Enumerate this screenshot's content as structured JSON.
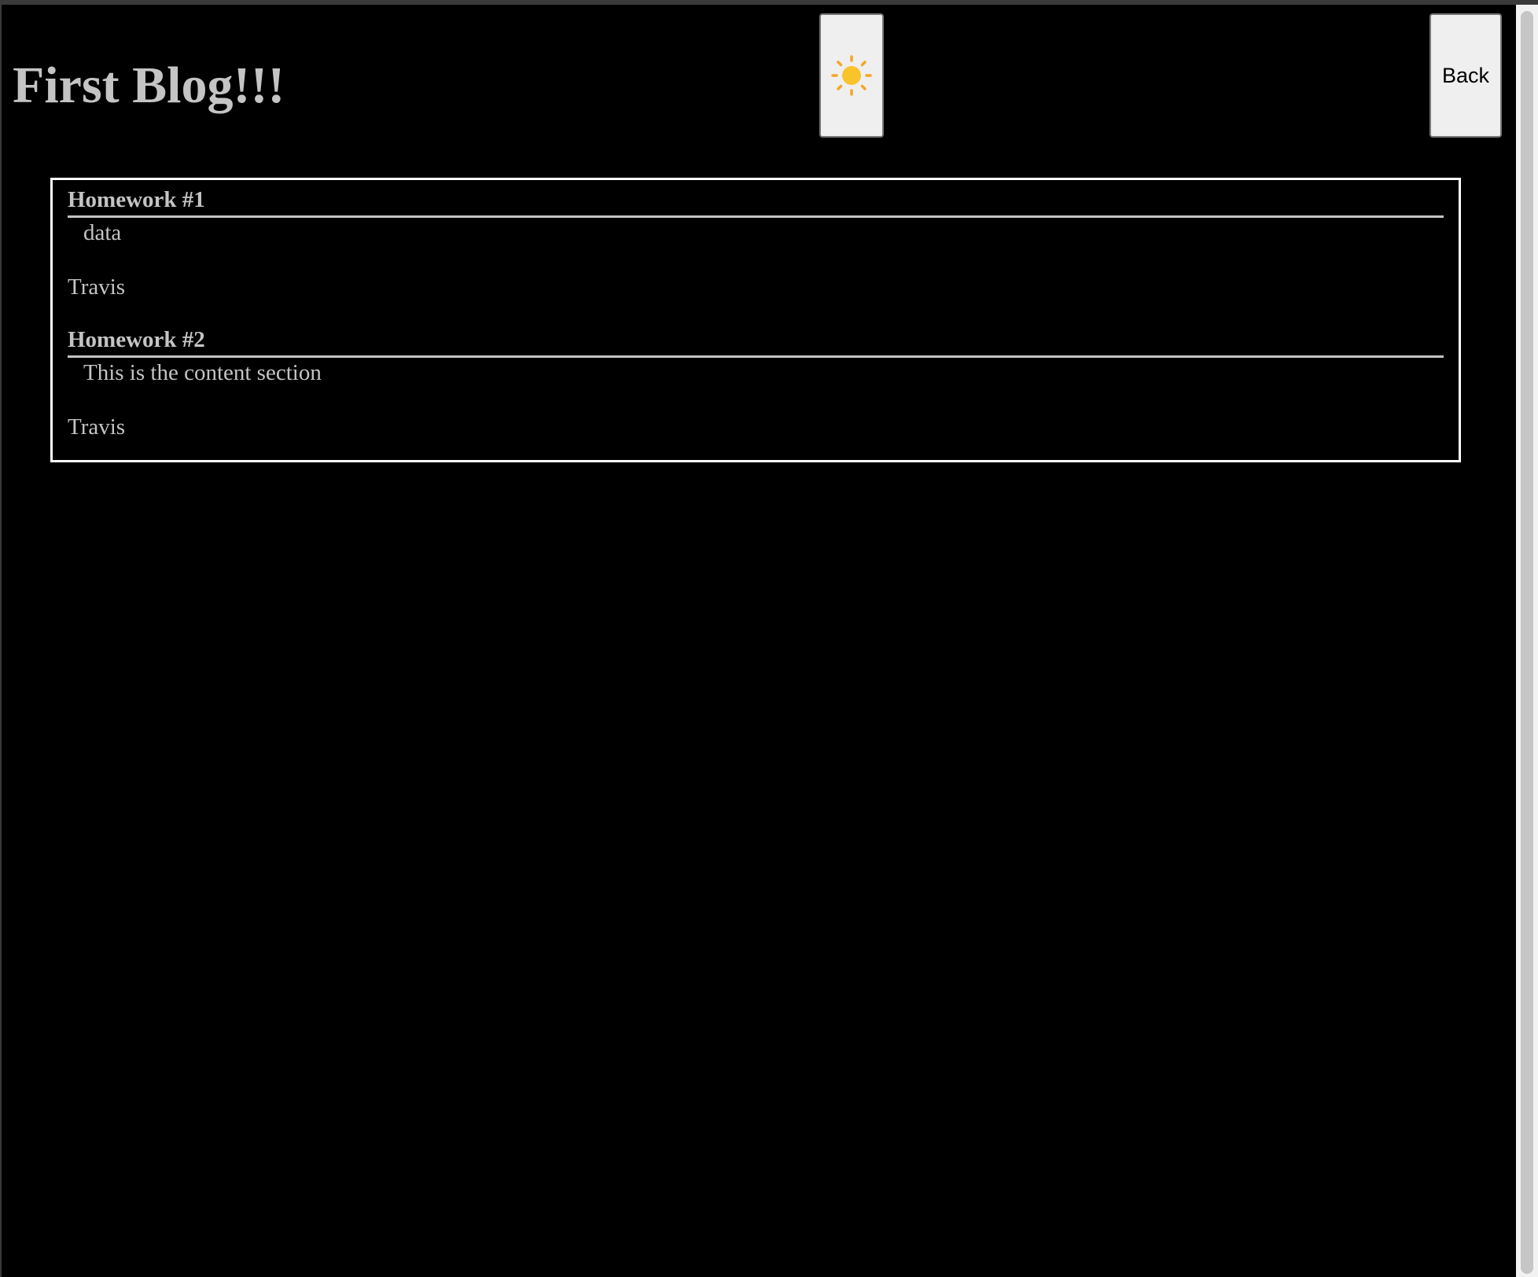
{
  "page": {
    "title": "First Blog!!!",
    "background_color": "#000000",
    "text_color": "#c4c4c4",
    "border_color": "#ffffff"
  },
  "header": {
    "theme_toggle": {
      "icon": "sun-icon",
      "icon_color": "#f9c32c"
    },
    "back_label": "Back"
  },
  "posts": [
    {
      "title": "Homework #1",
      "content": "data",
      "author": "Travis"
    },
    {
      "title": "Homework #2",
      "content": "This is the content section",
      "author": "Travis"
    }
  ]
}
